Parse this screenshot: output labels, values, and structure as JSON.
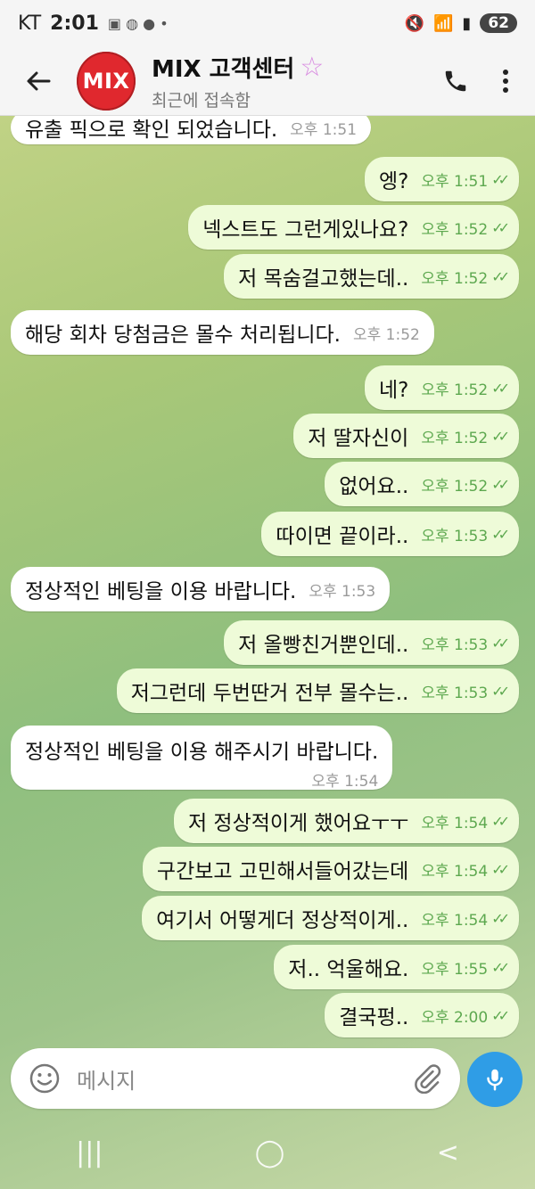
{
  "status": {
    "carrier": "KT",
    "time": "2:01",
    "battery": "62"
  },
  "header": {
    "avatar_text": "MIX",
    "title": "MIX 고객센터",
    "title_emoji": "☆",
    "subtitle": "최근에 접속함"
  },
  "messages": [
    {
      "dir": "in",
      "text": "유출 픽으로 확인 되었습니다.",
      "time": "오후 1:51"
    },
    {
      "dir": "out",
      "text": "엥?",
      "time": "오후 1:51"
    },
    {
      "dir": "out",
      "text": "넥스트도 그런게있나요?",
      "time": "오후 1:52"
    },
    {
      "dir": "out",
      "text": "저 목숨걸고했는데..",
      "time": "오후 1:52"
    },
    {
      "dir": "in",
      "text": "해당 회차 당첨금은 몰수 처리됩니다.",
      "time": "오후 1:52"
    },
    {
      "dir": "out",
      "text": "네?",
      "time": "오후 1:52"
    },
    {
      "dir": "out",
      "text": "저 딸자신이",
      "time": "오후 1:52"
    },
    {
      "dir": "out",
      "text": "없어요..",
      "time": "오후 1:52"
    },
    {
      "dir": "out",
      "text": "따이면 끝이라..",
      "time": "오후 1:53"
    },
    {
      "dir": "in",
      "text": "정상적인 베팅을 이용 바랍니다.",
      "time": "오후 1:53"
    },
    {
      "dir": "out",
      "text": "저 올빵친거뿐인데..",
      "time": "오후 1:53"
    },
    {
      "dir": "out",
      "text": "저그런데 두번딴거 전부 몰수는..",
      "time": "오후 1:53"
    },
    {
      "dir": "in",
      "text": "정상적인 베팅을 이용 해주시기 바랍니다.",
      "time": "오후 1:54"
    },
    {
      "dir": "out",
      "text": "저 정상적이게 했어요ㅜㅜ",
      "time": "오후 1:54"
    },
    {
      "dir": "out",
      "text": "구간보고 고민해서들어갔는데",
      "time": "오후 1:54"
    },
    {
      "dir": "out",
      "text": "여기서 어떻게더 정상적이게..",
      "time": "오후 1:54"
    },
    {
      "dir": "out",
      "text": "저.. 억울해요.",
      "time": "오후 1:55"
    },
    {
      "dir": "out",
      "text": "결국펑..",
      "time": "오후 2:00"
    }
  ],
  "input": {
    "placeholder": "메시지"
  },
  "icons": {
    "back": "back-arrow-icon",
    "call": "phone-icon",
    "more": "more-vert-icon",
    "emoji": "emoji-icon",
    "attach": "paperclip-icon",
    "mic": "mic-icon"
  },
  "colors": {
    "outgoing_bubble": "#eefbd8",
    "incoming_bubble": "#ffffff",
    "accent": "#2f9de6",
    "read_check": "#5da84f"
  }
}
